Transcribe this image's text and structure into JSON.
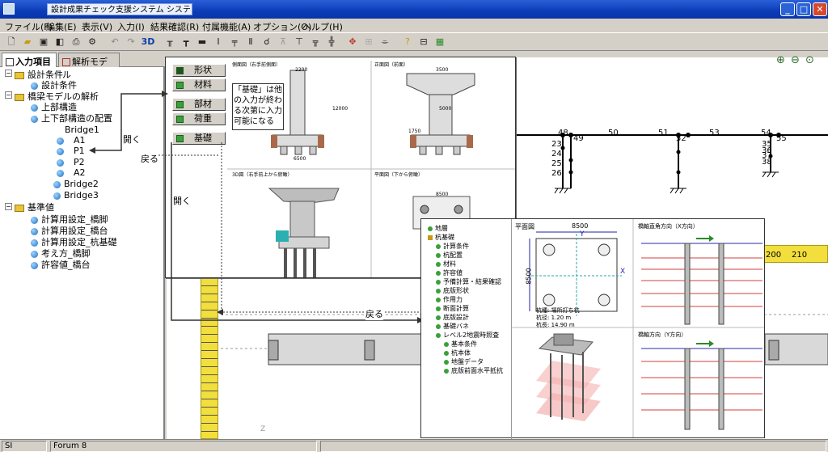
{
  "window": {
    "title": "設計成果チェック支援システム システムC"
  },
  "menu": [
    "ファイル(F)",
    "編集(E)",
    "表示(V)",
    "入力(I)",
    "結果確認(R)",
    "付属機能(A)",
    "オプション(O)",
    "ヘルプ(H)"
  ],
  "toolbar": {
    "label_3d": "3D"
  },
  "tabs": [
    "入力項目",
    "解析モデル"
  ],
  "tree": [
    {
      "label": "設計条件",
      "kind": "folder"
    },
    {
      "label": "設計条件",
      "kind": "node"
    },
    {
      "label": "橋梁モデルの解析",
      "kind": "folder"
    },
    {
      "label": "上部構造",
      "kind": "node"
    },
    {
      "label": "上下部構造の配置",
      "kind": "node"
    },
    {
      "label": "Bridge1",
      "kind": "text"
    },
    {
      "label": "A1",
      "kind": "node"
    },
    {
      "label": "P1",
      "kind": "node"
    },
    {
      "label": "P2",
      "kind": "node"
    },
    {
      "label": "A2",
      "kind": "node"
    },
    {
      "label": "Bridge2",
      "kind": "node"
    },
    {
      "label": "Bridge3",
      "kind": "node"
    },
    {
      "label": "基準値",
      "kind": "folder"
    },
    {
      "label": "計算用設定_橋脚",
      "kind": "node"
    },
    {
      "label": "計算用設定_橋台",
      "kind": "node"
    },
    {
      "label": "計算用設定_杭基礎",
      "kind": "node"
    },
    {
      "label": "考え方_橋脚",
      "kind": "node"
    },
    {
      "label": "許容値_橋台",
      "kind": "node"
    }
  ],
  "annotations": {
    "open1": "開く",
    "back1": "戻る",
    "open2": "開く",
    "back2": "戻る",
    "note": "「基礎」は他の入力が終わる次第に入力可能になる"
  },
  "popup1": {
    "buttons": [
      "形状",
      "材料",
      "部材",
      "荷重",
      "基礎"
    ],
    "view_labels": [
      "側面図（右手前側面）",
      "正面図（前面）",
      "3D図（右手前上から俯瞰）",
      "平面図（下から俯瞰）"
    ],
    "dims": [
      "2200",
      "12000",
      "6500",
      "3500",
      "5000",
      "1750",
      "8500"
    ]
  },
  "popup2": {
    "tree": [
      "地層",
      "杭基礎",
      "計算条件",
      "杭配置",
      "材料",
      "許容値",
      "予備計算・結果確認",
      "底版形状",
      "作用力",
      "断面計算",
      "底版設計",
      "基礎バネ",
      "レベル2地震時照査",
      "基本条件",
      "杭本体",
      "地盤データ",
      "底版前面水平抵抗"
    ],
    "plan_title": "平面図",
    "plan_width": "8500",
    "plan_height": "8500",
    "axis_y": "Y",
    "axis_x": "X",
    "pile_info1": "杭種: 場所打ち杭",
    "pile_info2": "杭径: 1.20 m",
    "pile_info3": "杭長: 14.90 m",
    "dir_x": "橋軸直角方向（X方向）",
    "dir_y": "橋軸方向（Y方向）"
  },
  "model": {
    "nodes": [
      "48",
      "49",
      "50",
      "51",
      "52",
      "53",
      "54",
      "55",
      "23",
      "24",
      "25",
      "26",
      "35",
      "36",
      "37",
      "38"
    ]
  },
  "ruler": {
    "labels": [
      "200",
      "210"
    ]
  },
  "status": {
    "left": "SI",
    "middle": "Forum 8"
  }
}
